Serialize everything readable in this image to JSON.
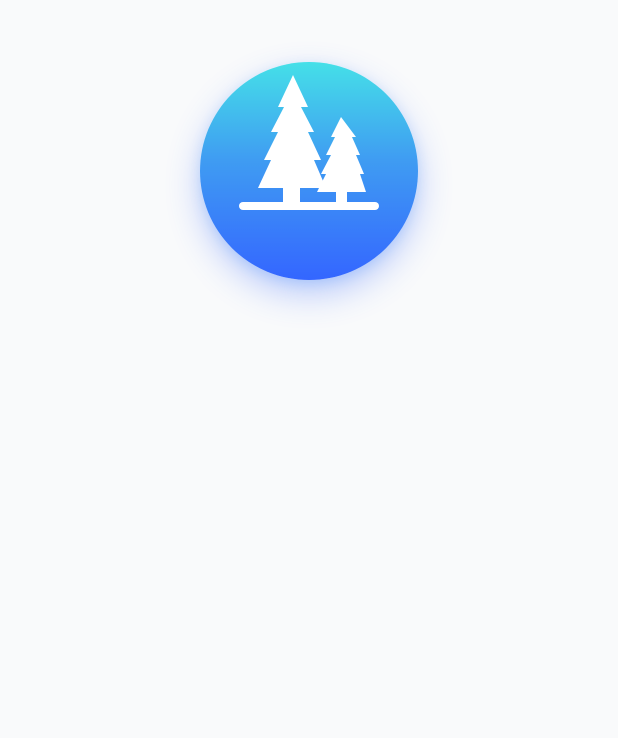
{
  "logo": {
    "icon": "pine-trees-icon",
    "gradient_top": "#45e0e8",
    "gradient_bottom": "#3466ff",
    "glyph_color": "#ffffff"
  },
  "background": "#f9fafb"
}
